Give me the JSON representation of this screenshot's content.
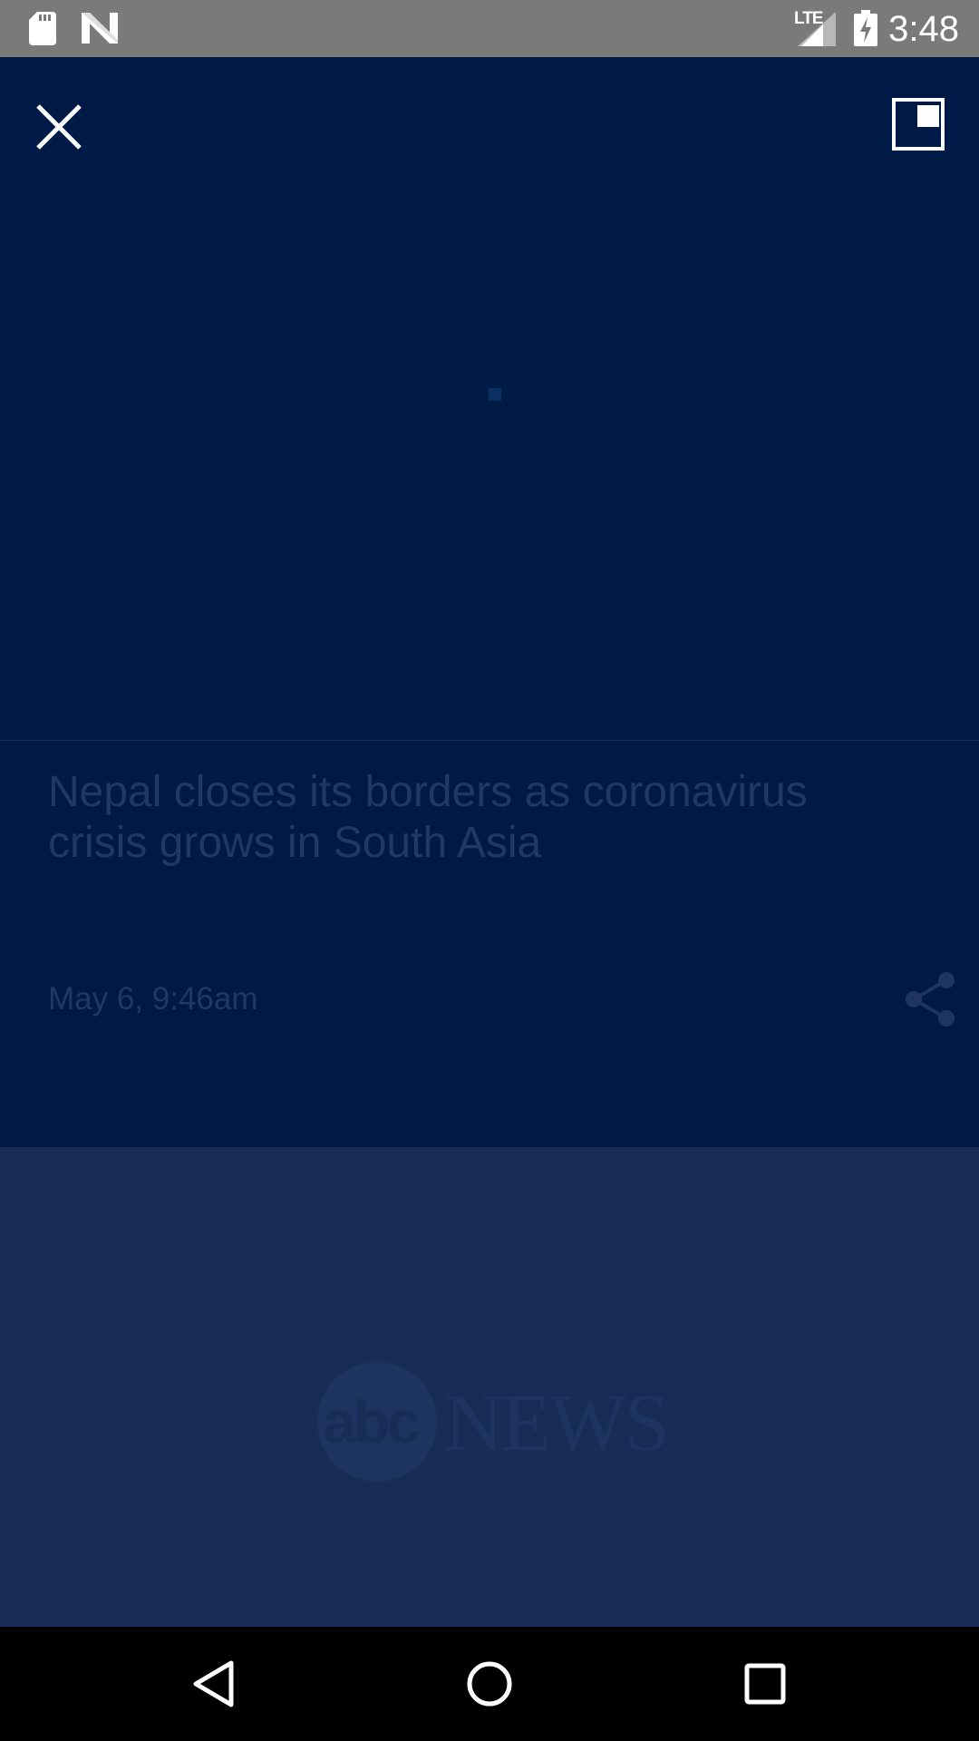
{
  "status_bar": {
    "time": "3:48",
    "network": "LTE",
    "icons": [
      "sd-card-icon",
      "n-notification-icon",
      "lte-signal-icon",
      "battery-charging-icon"
    ]
  },
  "player": {
    "close_icon": "close-icon",
    "pip_icon": "picture-in-picture-icon"
  },
  "article": {
    "headline": "Nepal closes its borders as coronavirus crisis grows in South Asia",
    "timestamp": "May 6, 9:46am",
    "share_icon": "share-icon"
  },
  "ad": {
    "logo_circle_text": "abc",
    "logo_word": "NEWS"
  },
  "nav_bar": {
    "buttons": [
      "back-icon",
      "home-icon",
      "recents-icon"
    ]
  },
  "colors": {
    "status_bar_bg": "#7a7a7a",
    "video_bg": "#001a46",
    "article_bg": "#001a46",
    "ad_bg": "#172d55",
    "headline_text": "#1f3866",
    "nav_bar_bg": "#000000"
  }
}
